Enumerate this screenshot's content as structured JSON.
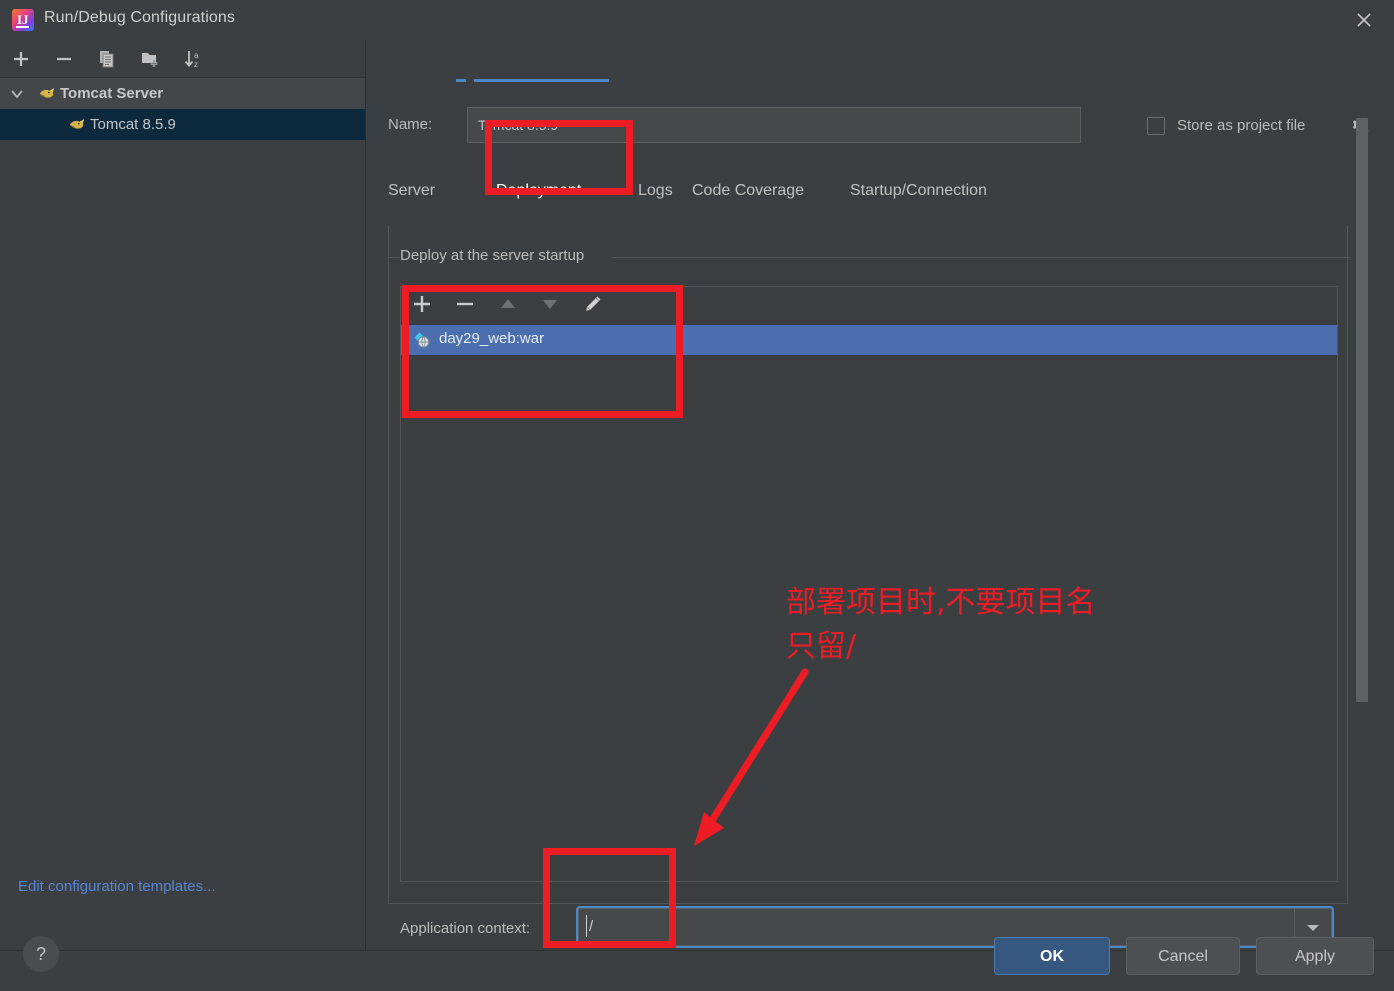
{
  "window": {
    "title": "Run/Debug Configurations",
    "app_icon": "intellij-idea-icon",
    "close_icon": "close-icon"
  },
  "sidebar": {
    "toolbar": [
      {
        "name": "add-configuration-button",
        "icon": "plus-icon"
      },
      {
        "name": "remove-configuration-button",
        "icon": "minus-icon"
      },
      {
        "name": "copy-configuration-button",
        "icon": "copy-icon"
      },
      {
        "name": "new-folder-button",
        "icon": "folder-add-icon"
      },
      {
        "name": "sort-configurations-button",
        "icon": "sort-alpha-icon"
      }
    ],
    "tree": [
      {
        "label": "Tomcat Server",
        "icon": "tomcat-icon",
        "type": "group",
        "expanded": true,
        "chevron": "chevron-down-icon"
      },
      {
        "label": "Tomcat 8.5.9",
        "icon": "tomcat-icon",
        "type": "child",
        "selected": true
      }
    ],
    "edit_templates_link": "Edit configuration templates..."
  },
  "form": {
    "name_label": "Name:",
    "name_value": "Tomcat 8.5.9",
    "name_placeholder": "",
    "store_as_project_file_label": "Store as project file",
    "store_as_project_file_checked": false,
    "store_gear_icon": "gear-icon"
  },
  "tabs": [
    {
      "label": "Server",
      "active": false
    },
    {
      "label": "Deployment",
      "active": true
    },
    {
      "label": "Logs",
      "active": false
    },
    {
      "label": "Code Coverage",
      "active": false
    },
    {
      "label": "Startup/Connection",
      "active": false
    }
  ],
  "deployment": {
    "section_title": "Deploy at the server startup",
    "toolbar": [
      {
        "name": "add-artifact-button",
        "icon": "plus-icon",
        "enabled": true
      },
      {
        "name": "remove-artifact-button",
        "icon": "minus-icon",
        "enabled": true
      },
      {
        "name": "move-up-button",
        "icon": "triangle-up-icon",
        "enabled": false
      },
      {
        "name": "move-down-button",
        "icon": "triangle-down-icon",
        "enabled": false
      },
      {
        "name": "edit-artifact-button",
        "icon": "pencil-icon",
        "enabled": true
      }
    ],
    "items": [
      {
        "label": "day29_web:war",
        "icon": "artifact-war-icon",
        "selected": true
      }
    ],
    "application_context_label": "Application context:",
    "application_context_value": "/",
    "application_context_dropdown_icon": "chevron-down-icon"
  },
  "dialog_buttons": {
    "help": "?",
    "ok": "OK",
    "cancel": "Cancel",
    "apply": "Apply"
  },
  "annotations": {
    "note_text": "部署项目时,不要项目名\n只留/",
    "color": "#ee1c25",
    "boxes": [
      "deployment-tab",
      "deployment-list",
      "application-context-field"
    ],
    "arrow": "red-arrow-pointing-to-application-context"
  },
  "colors": {
    "background": "#3c3f41",
    "selection_blue": "#4b6eaf",
    "tree_selection": "#0d293e",
    "accent_link": "#5686d6",
    "tab_underline": "#4f87c7",
    "annotation_red": "#ee1c25",
    "ok_button": "#365880"
  }
}
